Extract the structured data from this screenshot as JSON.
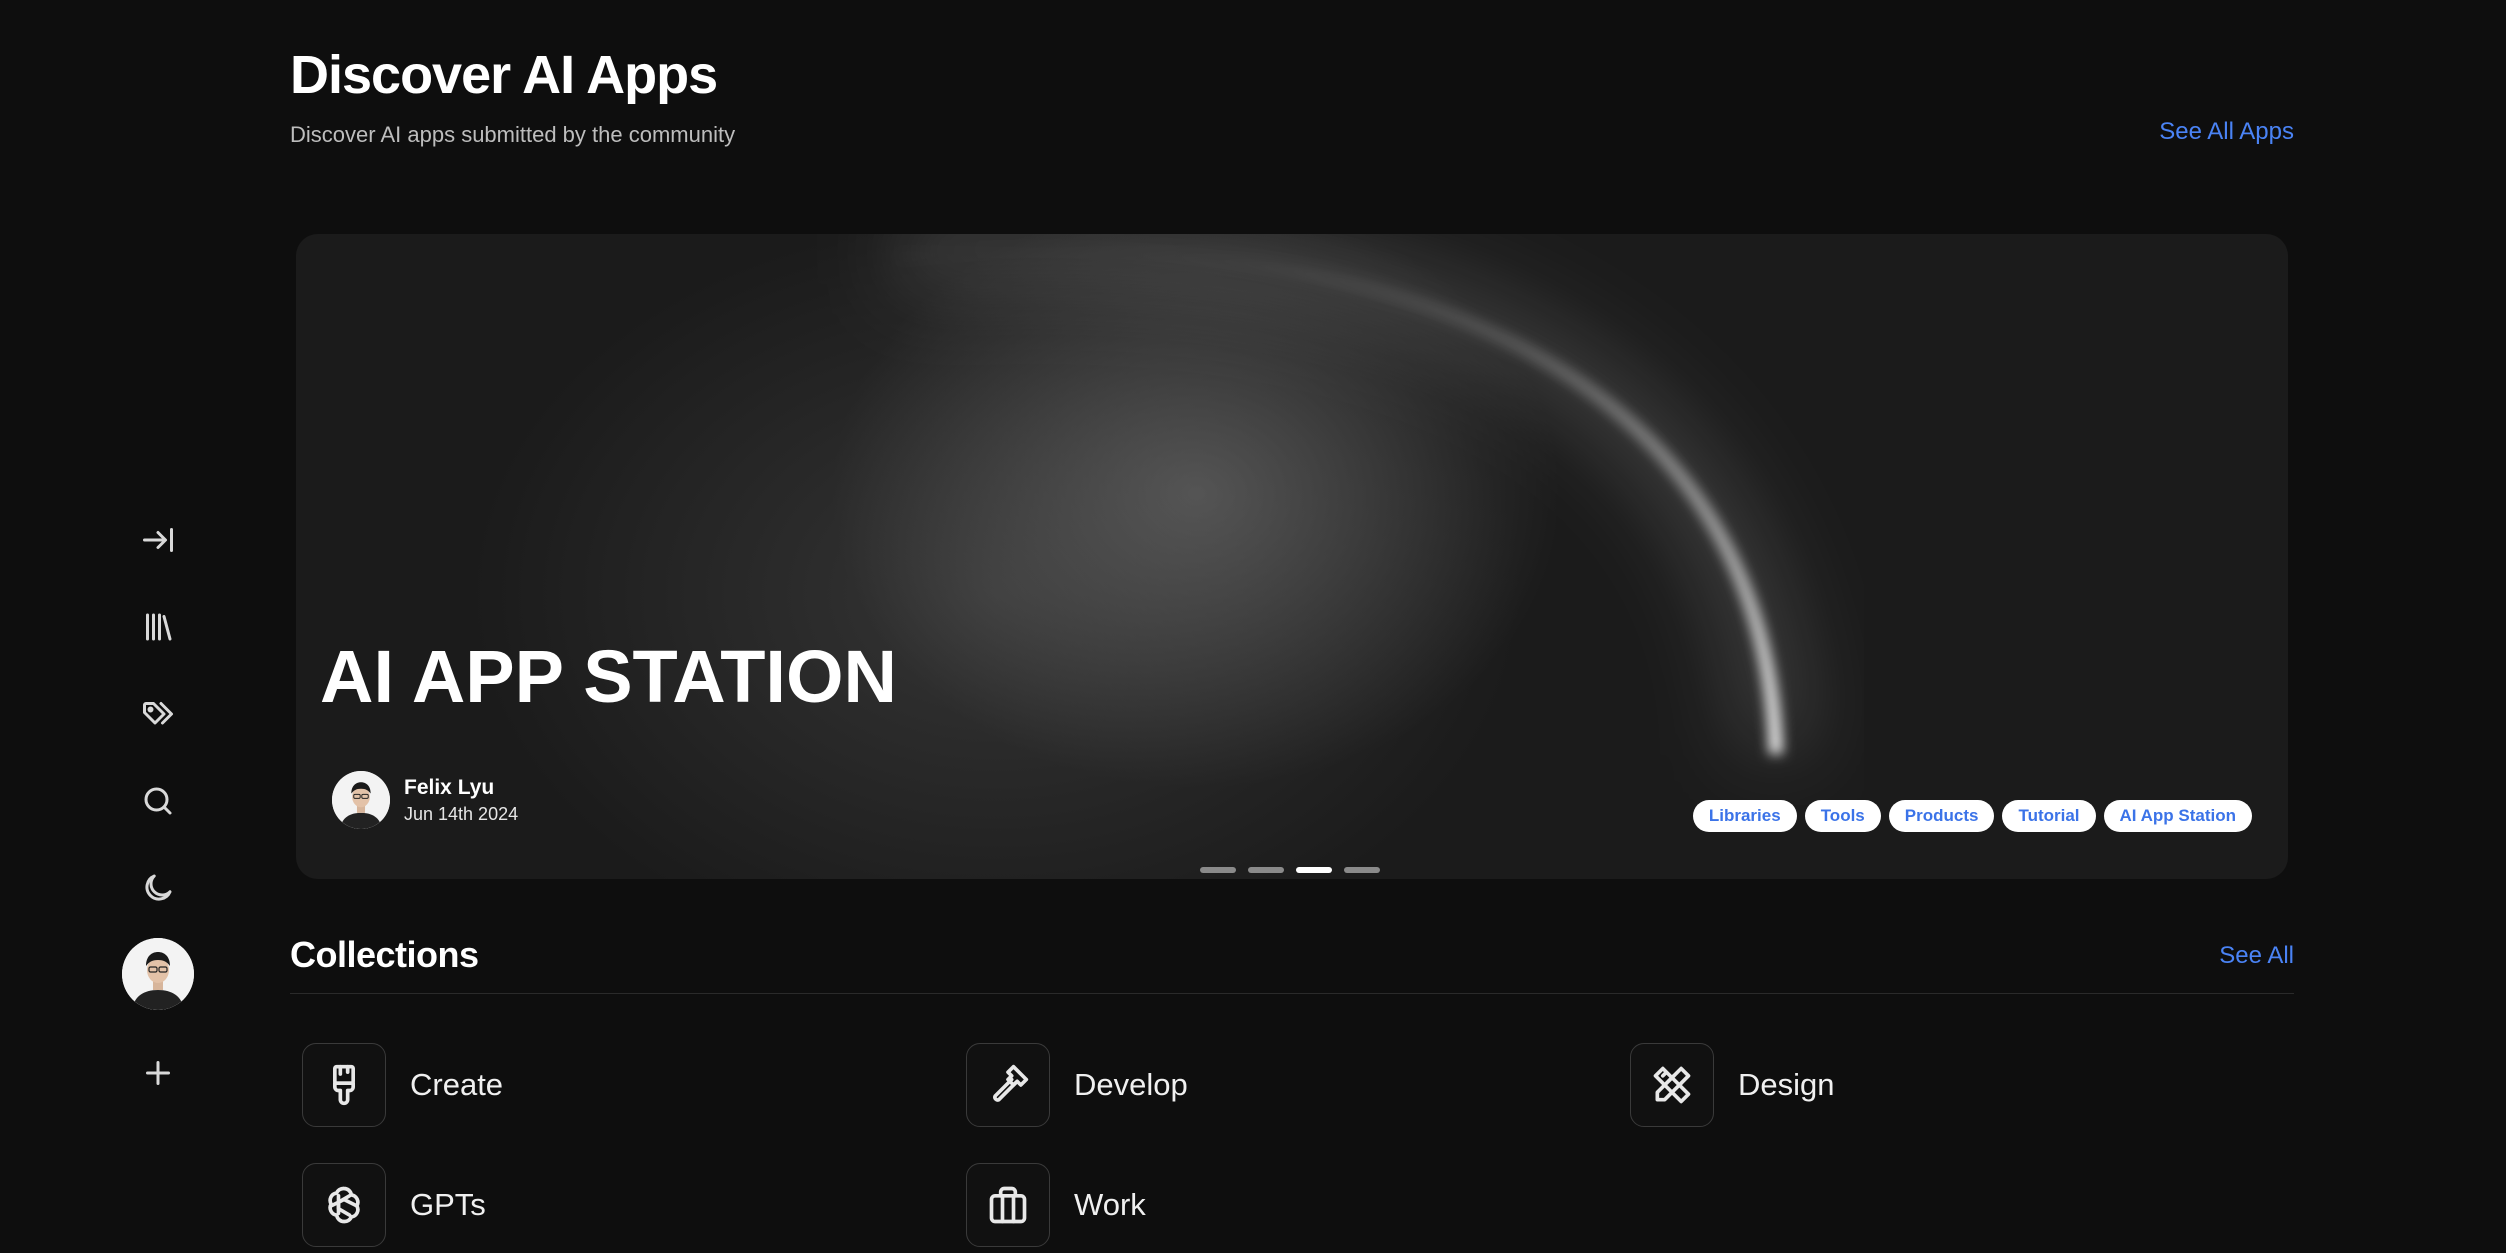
{
  "header": {
    "title": "Discover AI Apps",
    "subtitle": "Discover AI apps submitted by the community",
    "see_all_label": "See All Apps"
  },
  "sidebar": {
    "items": [
      {
        "name": "expand",
        "icon": "arrow-right-to-line-icon"
      },
      {
        "name": "library",
        "icon": "library-icon"
      },
      {
        "name": "tags",
        "icon": "tags-icon"
      },
      {
        "name": "search",
        "icon": "search-icon"
      },
      {
        "name": "theme",
        "icon": "moon-icon"
      },
      {
        "name": "add",
        "icon": "plus-icon"
      }
    ]
  },
  "hero": {
    "title": "AI APP STATION",
    "author": "Felix Lyu",
    "date": "Jun 14th 2024",
    "tags": [
      "Libraries",
      "Tools",
      "Products",
      "Tutorial",
      "AI App Station"
    ],
    "slides": 4,
    "active_slide": 3
  },
  "collections": {
    "title": "Collections",
    "see_all_label": "See All",
    "items": [
      {
        "label": "Create",
        "icon": "paintbrush-icon"
      },
      {
        "label": "Develop",
        "icon": "hammer-icon"
      },
      {
        "label": "Design",
        "icon": "pencil-ruler-icon"
      },
      {
        "label": "GPTs",
        "icon": "openai-icon"
      },
      {
        "label": "Work",
        "icon": "briefcase-icon"
      }
    ]
  },
  "colors": {
    "background": "#0e0e0e",
    "accent": "#4a83f5",
    "tag_text": "#3b73e8"
  }
}
